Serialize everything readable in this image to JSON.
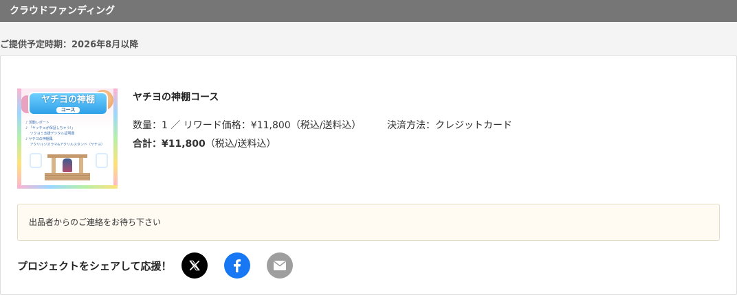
{
  "header": {
    "title": "クラウドファンディング"
  },
  "delivery": {
    "text": "ご提供予定時期：2026年8月以降"
  },
  "item": {
    "title": "ヤチヨの神棚コース",
    "details": "数量：1 ／ リワード価格：¥11,800（税込/送料込）",
    "payment": "決済方法：クレジットカード",
    "total_label": "合計：¥11,800",
    "total_note": "（税込/送料込）",
    "thumbnail": {
      "banner_title": "ヤチヨの神棚",
      "banner_sub": "コース",
      "lines": [
        "♪ 活動レポート",
        "♪ 「ヤッチョが保証しちゃう!」",
        "　 ツクヨミ支援デジタル証明書",
        "♪ ヤチヨの神棚風",
        "　 アクリルジオラマ&アクリルスタンド（ヤチヨ）"
      ]
    }
  },
  "notice": {
    "text": "出品者からのご連絡をお待ち下さい"
  },
  "share": {
    "label": "プロジェクトをシェアして応援！",
    "buttons": [
      {
        "icon": "x-logo-icon",
        "color": "#000000"
      },
      {
        "icon": "facebook-icon",
        "color": "#1877f2"
      },
      {
        "icon": "mail-icon",
        "color": "#9e9e9e"
      }
    ]
  }
}
